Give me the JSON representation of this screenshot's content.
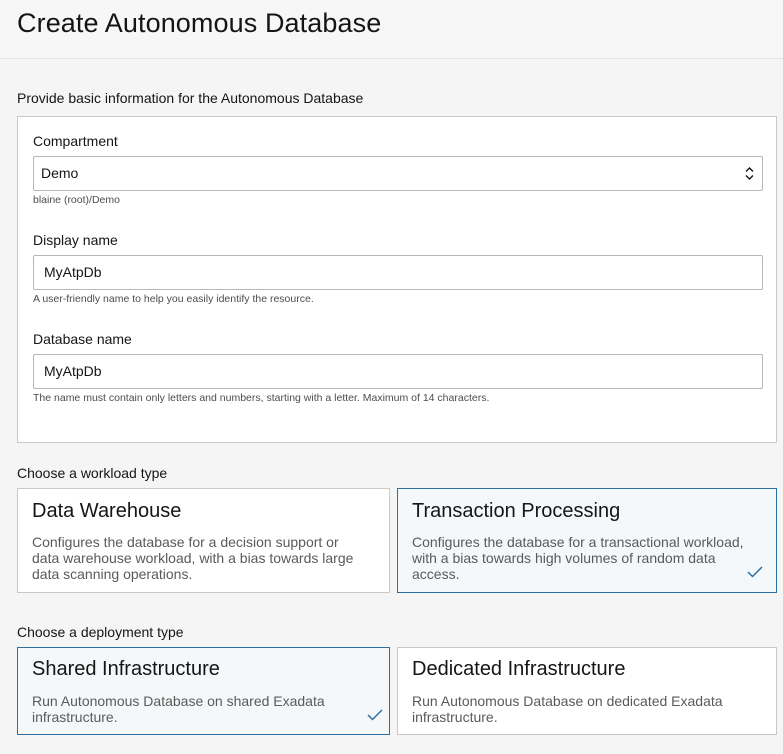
{
  "page": {
    "title": "Create Autonomous Database"
  },
  "basic_info": {
    "section_label": "Provide basic information for the Autonomous Database",
    "compartment": {
      "label": "Compartment",
      "value": "Demo",
      "help": "blaine (root)/Demo"
    },
    "display_name": {
      "label": "Display name",
      "value": "MyAtpDb",
      "help": "A user-friendly name to help you easily identify the resource."
    },
    "database_name": {
      "label": "Database name",
      "value": "MyAtpDb",
      "help": "The name must contain only letters and numbers, starting with a letter. Maximum of 14 characters."
    }
  },
  "workload": {
    "section_label": "Choose a workload type",
    "options": [
      {
        "title": "Data Warehouse",
        "desc_lines": [
          "Configures the database for a decision support or",
          "data warehouse workload, with a bias towards large",
          "data scanning operations."
        ],
        "selected": false
      },
      {
        "title": "Transaction Processing",
        "desc_lines": [
          "Configures the database for a transactional workload,",
          "with a bias towards high volumes of random data",
          "access."
        ],
        "selected": true
      }
    ]
  },
  "deployment": {
    "section_label": "Choose a deployment type",
    "options": [
      {
        "title": "Shared Infrastructure",
        "desc_lines": [
          "Run Autonomous Database on shared Exadata",
          "infrastructure."
        ],
        "selected": true
      },
      {
        "title": "Dedicated Infrastructure",
        "desc_lines": [
          "Run Autonomous Database on dedicated Exadata",
          "infrastructure."
        ],
        "selected": false
      }
    ]
  },
  "colors": {
    "selected_border": "#2c6fa3",
    "selected_bg": "#f4f8fb",
    "check": "#2c6fa3"
  },
  "icons": {
    "select_arrows": "chevron-up-down-icon",
    "selected_marker": "checkmark-icon"
  }
}
